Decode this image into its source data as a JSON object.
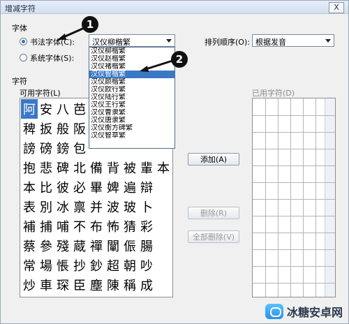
{
  "window": {
    "title": "增减字符",
    "close_label": "X"
  },
  "font_group": {
    "label": "字体",
    "option_calligraphy": "书法字体(C):",
    "option_system": "系统字体(S):",
    "font_combo_value": "汉仪柳楷繁",
    "sort_label": "排列顺序(O):",
    "sort_value": "根据发音"
  },
  "dropdown": {
    "items": [
      "汉仪赵楷繁",
      "汉仪褚楷繁",
      "汉仪智楷繁",
      "汉仪颜楷繁",
      "汉仪欧行繁",
      "汉仪陆行繁",
      "汉仪王行繁",
      "汉仪曹隶繁",
      "汉仪唐隶繁",
      "汉仪衡方碑繁",
      "汉仪智草繁"
    ],
    "selected_index": 2
  },
  "chars_group": {
    "label": "字符",
    "available_label": "可用字符(L)",
    "used_label": "已用字符(D)"
  },
  "grid": {
    "rows": [
      [
        "阿",
        "安",
        "八",
        "芭",
        "",
        "",
        "",
        "",
        ""
      ],
      [
        "稗",
        "扳",
        "般",
        "阪",
        "",
        "",
        "",
        "",
        ""
      ],
      [
        "謗",
        "磅",
        "鎊",
        "包",
        "",
        "",
        "",
        "",
        ""
      ],
      [
        "抱",
        "悲",
        "碑",
        "北",
        "備",
        "背",
        "被",
        "輩",
        "本"
      ],
      [
        "本",
        "比",
        "彼",
        "必",
        "畢",
        "婢",
        "遍",
        "辯",
        ""
      ],
      [
        "表",
        "別",
        "冰",
        "禀",
        "并",
        "波",
        "玻",
        "卜",
        ""
      ],
      [
        "補",
        "捕",
        "哺",
        "不",
        "布",
        "怖",
        "猜",
        "彩",
        ""
      ],
      [
        "蔡",
        "參",
        "殘",
        "蔵",
        "禪",
        "闡",
        "侲",
        "腸",
        ""
      ],
      [
        "常",
        "場",
        "悵",
        "抄",
        "鈔",
        "超",
        "朝",
        "吵",
        ""
      ],
      [
        "炒",
        "車",
        "琛",
        "臣",
        "塵",
        "陳",
        "稱",
        "成",
        ""
      ]
    ]
  },
  "buttons": {
    "add": "添加(A)",
    "delete": "删除(R)",
    "delete_all": "全部删除(V)"
  },
  "callouts": [
    "1",
    "2"
  ],
  "watermark": {
    "text": "冰糖安卓网"
  }
}
